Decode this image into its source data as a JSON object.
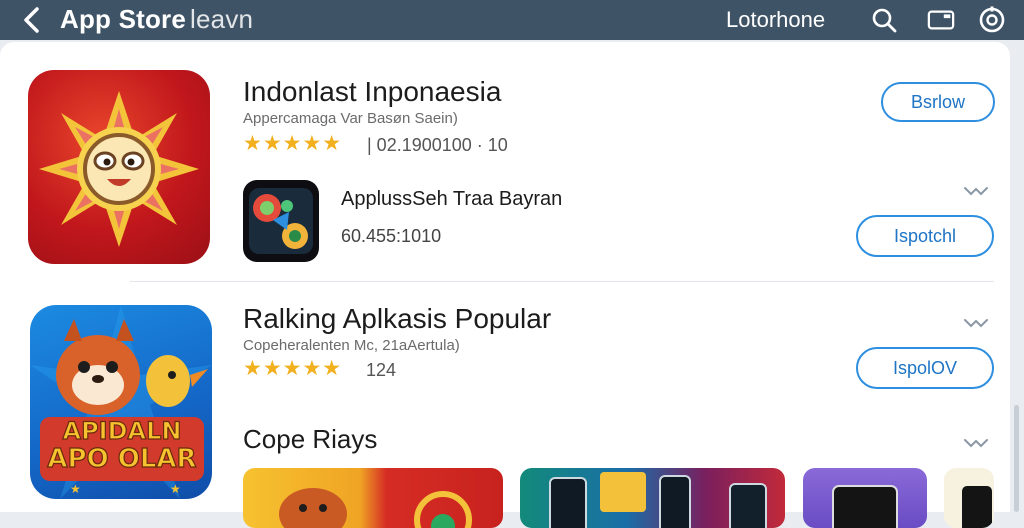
{
  "topbar": {
    "title": "App Store",
    "title_suffix": "leavn",
    "location_label": "Lotorhone",
    "icons": [
      "back-arrow-icon",
      "search-icon",
      "tablet-icon",
      "settings-icon"
    ]
  },
  "app1": {
    "name": "Indonlast Inponaesia",
    "subtitle": "Appercamaga Var Basøn Saein)",
    "rating_stars": 5,
    "stars_text": "★★★★★",
    "meta": "|   02.1900100  · 10",
    "button": "Bsrlow"
  },
  "sub_app": {
    "name": "ApplussSeh Traa Bayran",
    "meta": "60.455:1010",
    "button": "Ispotchl"
  },
  "app2": {
    "name": "Ralking Aplkasis Popular",
    "subtitle": "Copeheralenten Mc, 21aAertula)",
    "rating_stars": 5,
    "stars_text": "★★★★★",
    "meta": "124",
    "button": "IspolOV",
    "icon_text_line1": "APIDALN",
    "icon_text_line2": "APO OLAR"
  },
  "section": {
    "title": "Cope Riays"
  },
  "colors": {
    "topbar": "#3f5366",
    "accent": "#2e8fe0",
    "star": "#f2b01e"
  }
}
